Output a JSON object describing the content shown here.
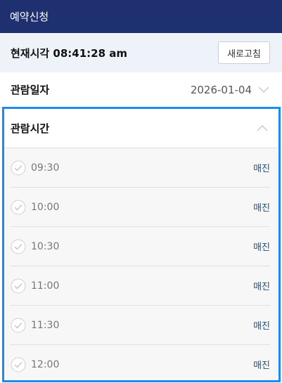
{
  "header": {
    "title": "예약신청"
  },
  "now": {
    "label": "현재시각 08:41:28 am",
    "refresh_label": "새로고침"
  },
  "date": {
    "label": "관람일자",
    "value": "2026-01-04"
  },
  "time": {
    "label": "관람시간",
    "slots": [
      {
        "time": "09:30",
        "status": "매진"
      },
      {
        "time": "10:00",
        "status": "매진"
      },
      {
        "time": "10:30",
        "status": "매진"
      },
      {
        "time": "11:00",
        "status": "매진"
      },
      {
        "time": "11:30",
        "status": "매진"
      },
      {
        "time": "12:00",
        "status": "매진"
      }
    ]
  },
  "colors": {
    "header_bg": "#1e3070",
    "panel_border": "#1a8cf0",
    "status_text": "#1f4f80"
  },
  "icons": {
    "date_toggle": "chevron-down-icon",
    "time_toggle": "chevron-up-icon",
    "slot_marker": "check-circle-icon"
  }
}
